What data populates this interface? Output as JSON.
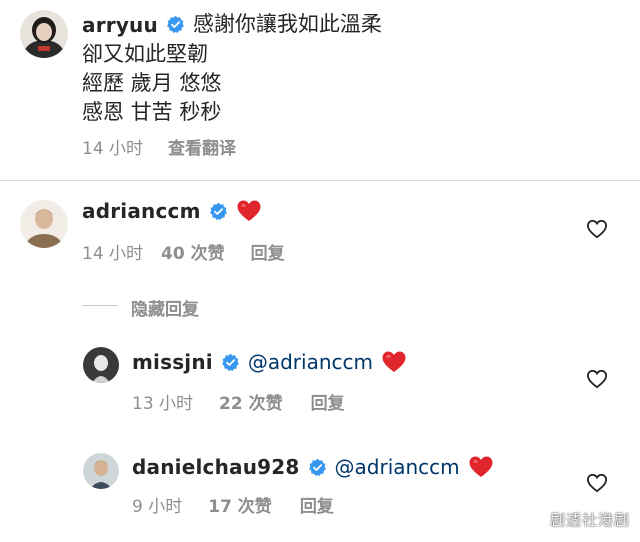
{
  "post_caption": {
    "username": "arryuu",
    "verified": true,
    "lines": [
      "感謝你讓我如此溫柔",
      "卻又如此堅韌",
      "經歷 歲月 悠悠",
      "感恩 甘苦 秒秒"
    ],
    "time": "14 小时",
    "translate": "查看翻译"
  },
  "comments": [
    {
      "username": "adrianccm",
      "verified": true,
      "text": "",
      "time": "14 小时",
      "likes": "40 次赞",
      "reply": "回复"
    }
  ],
  "hide_replies": "隐藏回复",
  "replies": [
    {
      "username": "missjni",
      "verified": true,
      "mention": "@adrianccm",
      "time": "13 小时",
      "likes": "22 次赞",
      "reply": "回复"
    },
    {
      "username": "danielchau928",
      "verified": true,
      "mention": "@adrianccm",
      "time": "9 小时",
      "likes": "17 次赞",
      "reply": "回复"
    }
  ],
  "watermark": "剧透社港剧",
  "colors": {
    "verified_blue": "#3897f0",
    "heart_red": "#ed4956",
    "mention_blue": "#00376b",
    "meta_gray": "#8e8e8e"
  },
  "icons": [
    "verified-badge-icon",
    "red-heart-emoji-icon",
    "like-heart-outline-icon"
  ]
}
